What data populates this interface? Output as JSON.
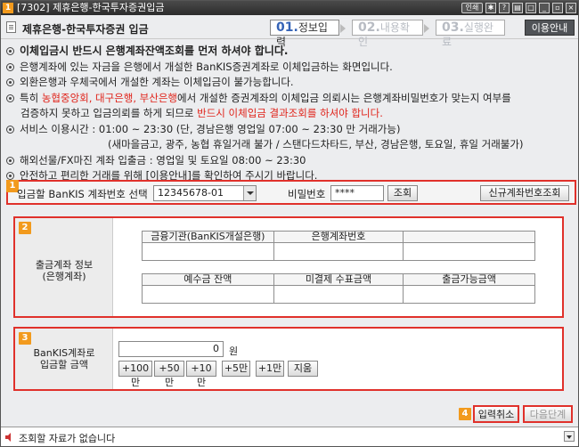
{
  "window": {
    "number": "1",
    "title": "[7302] 제휴은행-한국투자증권입금",
    "btn_link": "인쇄"
  },
  "header": {
    "title": "제휴은행-한국투자증권 입금",
    "steps": [
      {
        "num": "01.",
        "label": "정보입력"
      },
      {
        "num": "02.",
        "label": "내용확인"
      },
      {
        "num": "03.",
        "label": "실행완료"
      }
    ],
    "guide_button": "이용안내"
  },
  "notices": {
    "l1": "이체입금시 반드시 은행계좌잔액조회를 먼저 하셔야 합니다.",
    "l2": "은행계좌에 있는 자금을 은행에서 개설한 BanKIS증권계좌로 이체입금하는 화면입니다.",
    "l3": "외환은행과 우체국에서 개설한 계좌는 이체입금이 불가능합니다.",
    "l4a": "특히 ",
    "l4b": "농협중앙회, 대구은행, 부산은행",
    "l4c": "에서 개설한 증권계좌의 이체입금 의뢰시는 은행계좌비밀번호가 맞는지 여부를",
    "l5a": "검증하지 못하고 입금의뢰를 하게 되므로 ",
    "l5b": "반드시 이체입금 결과조회를 하셔야 합니다.",
    "l6": "서비스 이용시간 : 01:00 ~ 23:30 (단, 경남은행 영업일 07:00 ~ 23:30 만 거래가능)",
    "l7": "(새마을금고, 광주, 농협 휴일거래 불가 / 스탠다드차타드, 부산, 경남은행, 토요일, 휴일 거래불가)",
    "l8": "해외선물/FX마진 계좌 입출금 : 영업일 및 토요일 08:00 ~ 23:30",
    "l9": "안전하고 편리한 거래를 위해 [이용안내]를 확인하여 주시기 바랍니다."
  },
  "section1": {
    "badge": "1",
    "label": "입금할 BanKIS 계좌번호 선택",
    "account": "12345678-01",
    "password_label": "비밀번호",
    "password_value": "****",
    "query_button": "조회",
    "new_account_button": "신규계좌번호조회"
  },
  "section2": {
    "badge": "2",
    "side_line1": "출금계좌 정보",
    "side_line2": "(은행계좌)",
    "headers1": [
      "금융기관(BanKIS개설은행)",
      "은행계좌번호",
      ""
    ],
    "headers2": [
      "예수금 잔액",
      "미결제 수표금액",
      "출금가능금액"
    ]
  },
  "section3": {
    "badge": "3",
    "side_line1": "BanKIS계좌로",
    "side_line2": "입금할 금액",
    "amount": "0",
    "unit": "원",
    "quick": [
      "+100만",
      "+50만",
      "+10만",
      "+5만",
      "+1만",
      "지움"
    ]
  },
  "section4": {
    "badge": "4",
    "cancel": "입력취소",
    "next": "다음단계"
  },
  "status": {
    "message": "조회할 자료가 없습니다"
  }
}
